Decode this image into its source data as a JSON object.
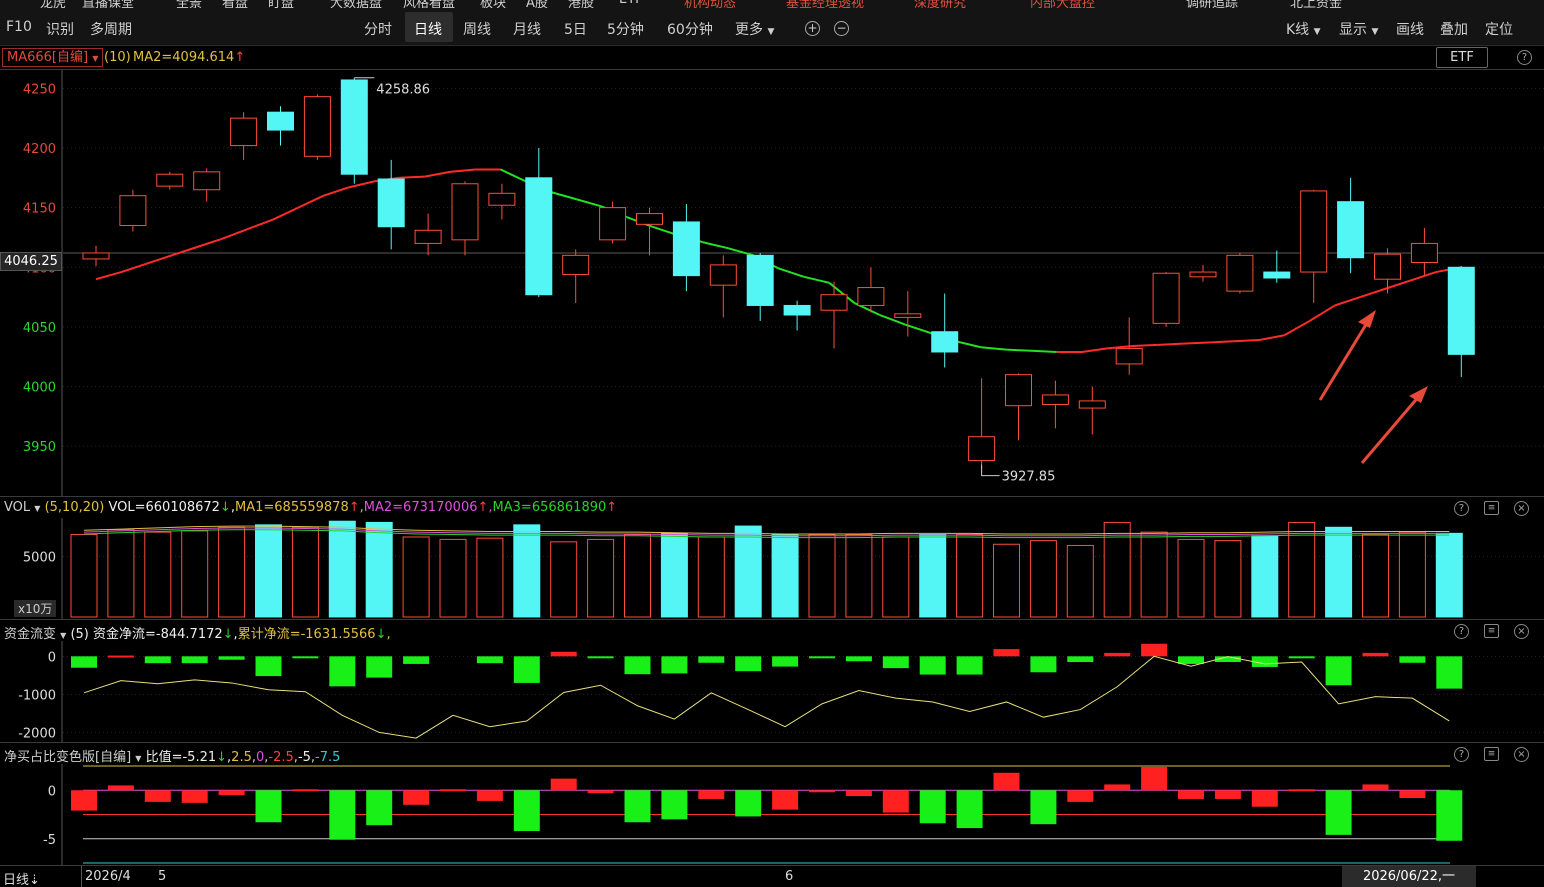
{
  "top_strip": {
    "items": [
      {
        "label": "龙虎",
        "red": false
      },
      {
        "label": "直播课堂",
        "red": false
      },
      {
        "label": "全景",
        "red": false
      },
      {
        "label": "看盘",
        "red": false
      },
      {
        "label": "盯盘",
        "red": false
      },
      {
        "label": "大数据盘",
        "red": false
      },
      {
        "label": "风格看盘",
        "red": false
      },
      {
        "label": "板块",
        "red": false
      },
      {
        "label": "A股",
        "red": false
      },
      {
        "label": "港股",
        "red": false
      },
      {
        "label": "ETF",
        "red": false
      },
      {
        "label": "机构动态",
        "red": true
      },
      {
        "label": "基金经理透视",
        "red": true
      },
      {
        "label": "深度研究",
        "red": true
      },
      {
        "label": "内部大盘控",
        "red": true
      },
      {
        "label": "调研追踪",
        "red": false
      },
      {
        "label": "北上资金",
        "red": false
      }
    ]
  },
  "toolbar": {
    "left": [
      "F10",
      "识别",
      "多周期"
    ],
    "periods": [
      "分时",
      "日线",
      "周线",
      "月线",
      "5日",
      "5分钟",
      "60分钟",
      "更多"
    ],
    "active_period": "日线",
    "zoom_in": "+",
    "zoom_out": "−",
    "right": [
      "K线",
      "显示",
      "画线",
      "叠加",
      "定位"
    ]
  },
  "info": {
    "ma_select": "MA666[自编]",
    "ma_param": "(10)",
    "ma2": "MA2=4094.614",
    "etf": "ETF",
    "help": "?"
  },
  "price_axis": {
    "ticks": [
      4250,
      4200,
      4150,
      4100,
      4050,
      4000,
      3950
    ],
    "current": "4046.25",
    "high_label": "4258.86",
    "low_label": "3927.85"
  },
  "colors": {
    "up": "#ff4d3a",
    "down": "#54f5f5",
    "ma_up": "#ff2a2a",
    "ma_down": "#22e022",
    "axis_label": "#e5493a",
    "grid": "#1d2a2d",
    "green_bar": "#18f018",
    "red_bar": "#ff2020"
  },
  "vol_panel": {
    "label": "VOL",
    "params": "(5,10,20)",
    "vol": "VOL=660108672",
    "ma1": "MA1=685559878",
    "ma2": "MA2=673170006",
    "ma3": "MA3=656861890",
    "tick": "5000",
    "unit": "x10万"
  },
  "flow_panel": {
    "label": "资金流变",
    "params": "(5)",
    "net": "资金净流=-844.7172",
    "cum": "累计净流=-1631.5566",
    "ticks": [
      "0",
      "-1000",
      "-2000"
    ]
  },
  "ratio_panel": {
    "label": "净买占比变色版[自编]",
    "value": "比值=-5.21",
    "lv1": "2.5",
    "lv2": "0",
    "lv3": "-2.5",
    "lv4": "-5",
    "lv5": "-7.5",
    "ticks": [
      "0",
      "-5"
    ]
  },
  "date_bar": {
    "period": "日线",
    "d1": "2026/4",
    "d2": "5",
    "d3": "6",
    "cursor": "2026/06/22,一"
  },
  "chart_data": {
    "type": "candlestick",
    "ylim": [
      3915,
      4262
    ],
    "candles": [
      {
        "o": 4107,
        "c": 4112,
        "h": 4118,
        "l": 4101
      },
      {
        "o": 4135,
        "c": 4160,
        "h": 4165,
        "l": 4130
      },
      {
        "o": 4168,
        "c": 4178,
        "h": 4180,
        "l": 4165
      },
      {
        "o": 4165,
        "c": 4180,
        "h": 4183,
        "l": 4155
      },
      {
        "o": 4202,
        "c": 4225,
        "h": 4230,
        "l": 4190
      },
      {
        "o": 4230,
        "c": 4215,
        "h": 4235,
        "l": 4202
      },
      {
        "o": 4193,
        "c": 4243,
        "h": 4245,
        "l": 4190
      },
      {
        "o": 4257,
        "c": 4178,
        "h": 4258.86,
        "l": 4170
      },
      {
        "o": 4174,
        "c": 4134,
        "h": 4190,
        "l": 4115
      },
      {
        "o": 4120,
        "c": 4131,
        "h": 4145,
        "l": 4110
      },
      {
        "o": 4123,
        "c": 4170,
        "h": 4172,
        "l": 4110
      },
      {
        "o": 4152,
        "c": 4162,
        "h": 4170,
        "l": 4140
      },
      {
        "o": 4175,
        "c": 4077,
        "h": 4200,
        "l": 4075
      },
      {
        "o": 4094,
        "c": 4110,
        "h": 4115,
        "l": 4070
      },
      {
        "o": 4123,
        "c": 4150,
        "h": 4155,
        "l": 4120
      },
      {
        "o": 4136,
        "c": 4145,
        "h": 4150,
        "l": 4110
      },
      {
        "o": 4138,
        "c": 4093,
        "h": 4153,
        "l": 4080
      },
      {
        "o": 4085,
        "c": 4102,
        "h": 4110,
        "l": 4058
      },
      {
        "o": 4110,
        "c": 4068,
        "h": 4112,
        "l": 4055
      },
      {
        "o": 4068,
        "c": 4060,
        "h": 4072,
        "l": 4047
      },
      {
        "o": 4064,
        "c": 4077,
        "h": 4088,
        "l": 4032
      },
      {
        "o": 4068,
        "c": 4083,
        "h": 4100,
        "l": 4062
      },
      {
        "o": 4058,
        "c": 4061,
        "h": 4080,
        "l": 4042
      },
      {
        "o": 4046,
        "c": 4029,
        "h": 4078,
        "l": 4016
      },
      {
        "o": 3938,
        "c": 3958,
        "h": 4007,
        "l": 3927.85
      },
      {
        "o": 3984,
        "c": 4010,
        "h": 4011,
        "l": 3955
      },
      {
        "o": 3985,
        "c": 3993,
        "h": 4005,
        "l": 3965
      },
      {
        "o": 3982,
        "c": 3988,
        "h": 4000,
        "l": 3960
      },
      {
        "o": 4019,
        "c": 4032,
        "h": 4058,
        "l": 4010
      },
      {
        "o": 4053,
        "c": 4095,
        "h": 4096,
        "l": 4050
      },
      {
        "o": 4092,
        "c": 4096,
        "h": 4102,
        "l": 4088
      },
      {
        "o": 4080,
        "c": 4110,
        "h": 4112,
        "l": 4078
      },
      {
        "o": 4096,
        "c": 4091,
        "h": 4114,
        "l": 4087
      },
      {
        "o": 4096,
        "c": 4164,
        "h": 4165,
        "l": 4070
      },
      {
        "o": 4155,
        "c": 4108,
        "h": 4175,
        "l": 4095
      },
      {
        "o": 4090,
        "c": 4111,
        "h": 4116,
        "l": 4078
      },
      {
        "o": 4104,
        "c": 4120,
        "h": 4133,
        "l": 4093
      },
      {
        "o": 4100,
        "c": 4027,
        "h": 4101,
        "l": 4008
      }
    ],
    "ma": [
      4090,
      4096,
      4103,
      4110,
      4117,
      4124,
      4132,
      4140,
      4150,
      4160,
      4167,
      4172,
      4175,
      4176,
      4180,
      4182,
      4182,
      4172,
      4163,
      4157,
      4151,
      4142,
      4134,
      4127,
      4121,
      4116,
      4110,
      4099,
      4092,
      4087,
      4070,
      4060,
      4052,
      4045,
      4038,
      4033,
      4031,
      4030,
      4029,
      4029,
      4032,
      4034,
      4035,
      4036,
      4037,
      4038,
      4039,
      4043,
      4055,
      4068,
      4075,
      4082,
      4089,
      4096,
      4100
    ]
  },
  "vol_data": {
    "values": [
      6.8,
      7.2,
      7.0,
      7.1,
      7.4,
      7.6,
      7.4,
      7.9,
      7.8,
      6.6,
      6.4,
      6.5,
      7.6,
      6.2,
      6.4,
      6.8,
      6.9,
      6.6,
      7.5,
      6.8,
      6.8,
      6.8,
      6.6,
      6.8,
      6.8,
      6.0,
      6.3,
      5.9,
      7.8,
      7.0,
      6.4,
      6.3,
      6.7,
      7.8,
      7.4,
      6.8,
      7.0,
      6.9
    ],
    "ma": [
      7.0,
      7.1,
      7.2,
      7.3,
      7.35,
      7.35,
      7.3,
      7.25,
      7.1,
      7.0,
      6.95,
      6.9,
      6.9,
      6.9,
      6.85,
      6.85,
      6.8,
      6.75,
      6.75,
      6.7,
      6.7,
      6.7,
      6.75,
      6.75,
      6.75,
      6.7,
      6.7,
      6.7,
      6.75,
      6.75,
      6.8,
      6.8,
      6.85,
      6.9,
      6.9,
      6.9,
      6.9,
      6.9
    ],
    "ymax": 8.0
  },
  "flow_data": {
    "bars": [
      -300,
      20,
      -180,
      -180,
      -90,
      -520,
      -30,
      -790,
      -560,
      -200,
      0,
      -180,
      -700,
      120,
      -50,
      -470,
      -450,
      -170,
      -390,
      -270,
      -30,
      -130,
      -310,
      -480,
      -480,
      190,
      -420,
      -150,
      90,
      330,
      -200,
      -150,
      -280,
      -30,
      -760,
      90,
      -170,
      -850
    ],
    "line": [
      -960,
      -640,
      -720,
      -620,
      -700,
      -880,
      -930,
      -1550,
      -2000,
      -2150,
      -1550,
      -1850,
      -1700,
      -950,
      -760,
      -1300,
      -1650,
      -960,
      -1400,
      -1850,
      -1250,
      -900,
      -1100,
      -1200,
      -1450,
      -1200,
      -1600,
      -1400,
      -800,
      0,
      -260,
      -10,
      -200,
      -150,
      -1250,
      -1060,
      -1100,
      -1700
    ],
    "ylim": [
      -2200,
      350
    ]
  },
  "ratio_data": {
    "bars": [
      -2.1,
      0.5,
      -1.2,
      -1.3,
      -0.5,
      -3.3,
      0.1,
      -5.1,
      -3.6,
      -1.5,
      0.1,
      -1.1,
      -4.2,
      1.2,
      -0.3,
      -3.3,
      -3.0,
      -0.9,
      -2.7,
      -2.0,
      -0.1,
      -0.6,
      -2.3,
      -3.4,
      -3.9,
      1.8,
      -3.5,
      -1.2,
      0.6,
      2.4,
      -0.9,
      -0.9,
      -1.7,
      0.1,
      -4.6,
      0.6,
      -0.8,
      -5.21
    ],
    "ylim": [
      -7.5,
      2.5
    ]
  }
}
